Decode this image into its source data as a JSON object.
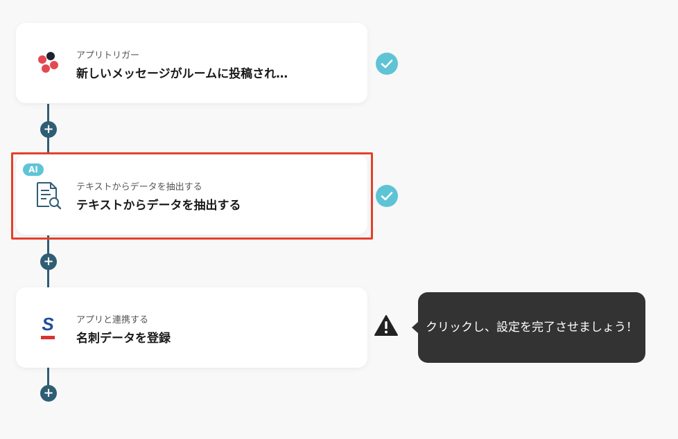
{
  "flow": {
    "steps": [
      {
        "subtitle": "アプリトリガー",
        "title": "新しいメッセージがルームに投稿され…",
        "icon": "chatwork-logo-icon",
        "status": "completed"
      },
      {
        "badge": "AI",
        "subtitle": "テキストからデータを抽出する",
        "title": "テキストからデータを抽出する",
        "icon": "document-search-icon",
        "status": "completed",
        "highlighted": true
      },
      {
        "subtitle": "アプリと連携する",
        "title": "名刺データを登録",
        "icon": "sansan-logo-icon",
        "status": "warning"
      }
    ],
    "add_step_label": "+"
  },
  "tooltip": {
    "text": "クリックし、設定を完了させましょう！"
  },
  "colors": {
    "background": "#f8f8f8",
    "connector": "#2f5d73",
    "check": "#5ec4d5",
    "highlight_border": "#e4402a",
    "tooltip_bg": "#333333",
    "ai_badge": "#5fc5d6"
  }
}
